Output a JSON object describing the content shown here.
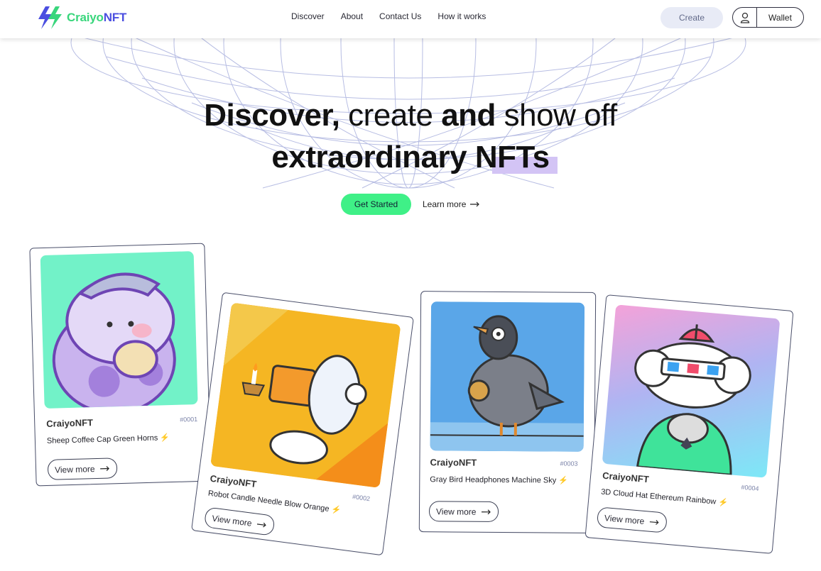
{
  "brand": {
    "part1": "Craiyo",
    "part2": "NFT"
  },
  "nav": [
    {
      "label": "Discover"
    },
    {
      "label": "About"
    },
    {
      "label": "Contact Us"
    },
    {
      "label": "How it works"
    }
  ],
  "header": {
    "create_label": "Create",
    "wallet_label": "Wallet"
  },
  "hero": {
    "line1": {
      "w1": "Discover,",
      "w2": " create ",
      "w3": "and",
      "w4": " show off"
    },
    "line2": "extraordinary NFTs",
    "cta_label": "Get Started",
    "learn_label": "Learn more"
  },
  "cards": [
    {
      "brand": "CraiyoNFT",
      "number": "#0001",
      "title": "Sheep Coffee Cap Green Horns",
      "view_label": "View more"
    },
    {
      "brand": "CraiyoNFT",
      "number": "#0002",
      "title": "Robot Candle Needle Blow Orange",
      "view_label": "View more"
    },
    {
      "brand": "CraiyoNFT",
      "number": "#0003",
      "title": "Gray Bird Headphones Machine Sky",
      "view_label": "View more"
    },
    {
      "brand": "CraiyoNFT",
      "number": "#0004",
      "title": "3D Cloud Hat Ethereum Rainbow",
      "view_label": "View more"
    }
  ],
  "colors": {
    "accent_green": "#3ff087",
    "brand_blue": "#4b4fe0",
    "highlight_purple": "#d3c4f5"
  },
  "icons": [
    "lightning-logo-icon",
    "user-icon",
    "arrow-right-icon",
    "bolt-icon"
  ]
}
